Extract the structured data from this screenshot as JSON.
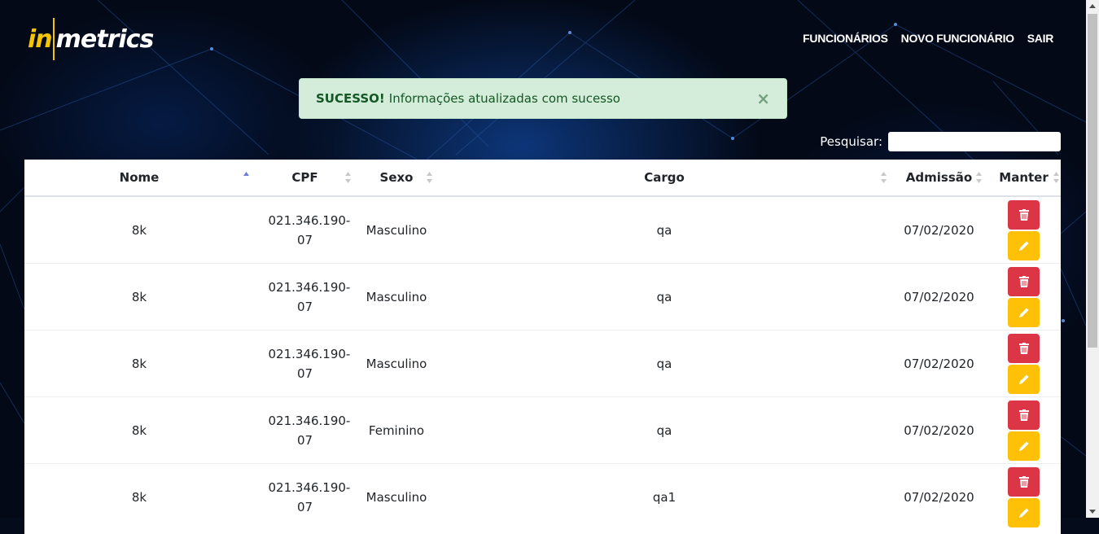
{
  "header": {
    "logo_in": "in",
    "logo_metrics": "metrics",
    "nav": [
      "FUNCIONÁRIOS",
      "NOVO FUNCIONÁRIO",
      "SAIR"
    ]
  },
  "alert": {
    "strong": "SUCESSO!",
    "message": "Informações atualizadas com sucesso",
    "close": "×"
  },
  "search": {
    "label": "Pesquisar:",
    "value": ""
  },
  "table": {
    "columns": [
      "Nome",
      "CPF",
      "Sexo",
      "Cargo",
      "Admissão",
      "Manter"
    ],
    "rows": [
      {
        "nome": "8k",
        "cpf": "021.346.190-07",
        "sexo": "Masculino",
        "cargo": "qa",
        "admissao": "07/02/2020"
      },
      {
        "nome": "8k",
        "cpf": "021.346.190-07",
        "sexo": "Masculino",
        "cargo": "qa",
        "admissao": "07/02/2020"
      },
      {
        "nome": "8k",
        "cpf": "021.346.190-07",
        "sexo": "Masculino",
        "cargo": "qa",
        "admissao": "07/02/2020"
      },
      {
        "nome": "8k",
        "cpf": "021.346.190-07",
        "sexo": "Feminino",
        "cargo": "qa",
        "admissao": "07/02/2020"
      },
      {
        "nome": "8k",
        "cpf": "021.346.190-07",
        "sexo": "Masculino",
        "cargo": "qa1",
        "admissao": "07/02/2020"
      }
    ]
  },
  "colors": {
    "brand_yellow": "#f6c500",
    "alert_bg": "#d4edda",
    "alert_text": "#155724",
    "delete_button": "#dc3545",
    "edit_button": "#ffc107",
    "sort_active": "#6c7fd8"
  }
}
